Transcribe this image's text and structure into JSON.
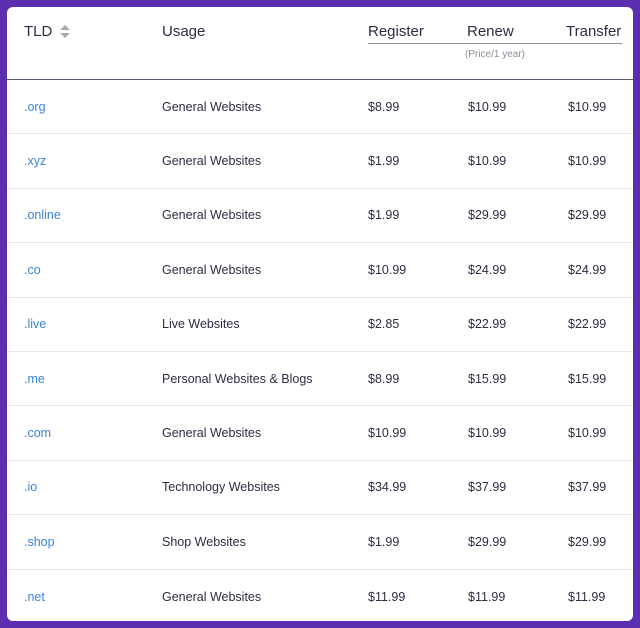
{
  "header": {
    "tld": "TLD",
    "usage": "Usage",
    "register": "Register",
    "renew": "Renew",
    "transfer": "Transfer",
    "price_note": "(Price/1 year)"
  },
  "rows": [
    {
      "tld": ".org",
      "usage": "General Websites",
      "register": "$8.99",
      "renew": "$10.99",
      "transfer": "$10.99"
    },
    {
      "tld": ".xyz",
      "usage": "General Websites",
      "register": "$1.99",
      "renew": "$10.99",
      "transfer": "$10.99"
    },
    {
      "tld": ".online",
      "usage": "General Websites",
      "register": "$1.99",
      "renew": "$29.99",
      "transfer": "$29.99"
    },
    {
      "tld": ".co",
      "usage": "General Websites",
      "register": "$10.99",
      "renew": "$24.99",
      "transfer": "$24.99"
    },
    {
      "tld": ".live",
      "usage": "Live Websites",
      "register": "$2.85",
      "renew": "$22.99",
      "transfer": "$22.99"
    },
    {
      "tld": ".me",
      "usage": "Personal Websites & Blogs",
      "register": "$8.99",
      "renew": "$15.99",
      "transfer": "$15.99"
    },
    {
      "tld": ".com",
      "usage": "General Websites",
      "register": "$10.99",
      "renew": "$10.99",
      "transfer": "$10.99"
    },
    {
      "tld": ".io",
      "usage": "Technology Websites",
      "register": "$34.99",
      "renew": "$37.99",
      "transfer": "$37.99"
    },
    {
      "tld": ".shop",
      "usage": "Shop Websites",
      "register": "$1.99",
      "renew": "$29.99",
      "transfer": "$29.99"
    },
    {
      "tld": ".net",
      "usage": "General Websites",
      "register": "$11.99",
      "renew": "$11.99",
      "transfer": "$11.99"
    }
  ],
  "colors": {
    "background": "#5b2fb0",
    "link": "#3b82d6",
    "text": "#2b2d42"
  },
  "icons": {
    "sort": "sort-icon"
  }
}
